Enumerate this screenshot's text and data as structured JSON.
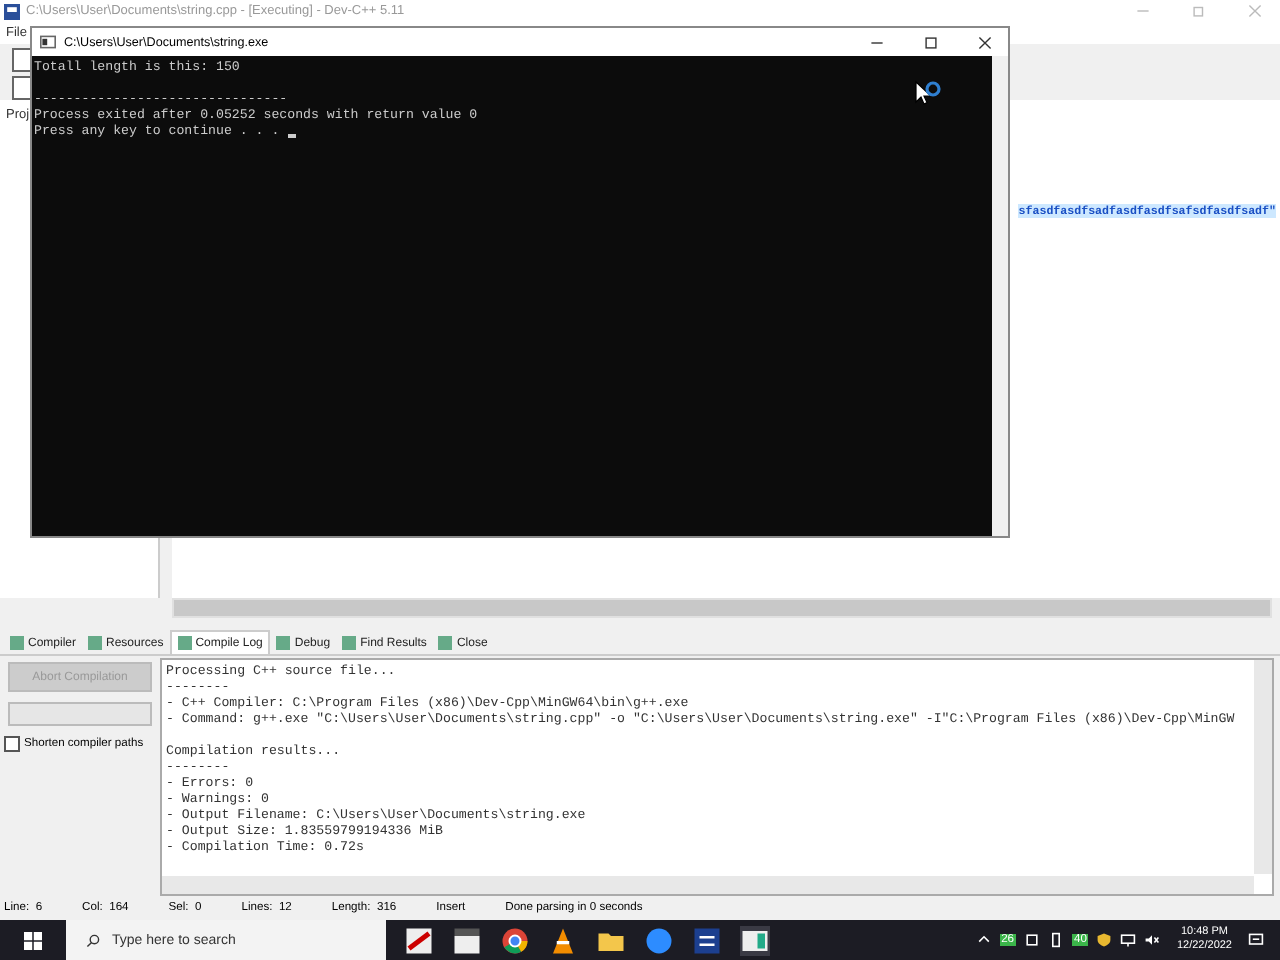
{
  "window": {
    "title": "C:\\Users\\User\\Documents\\string.cpp - [Executing] - Dev-C++ 5.11"
  },
  "menu": [
    "File"
  ],
  "project_tab": "Proj",
  "editor": {
    "visible_line": "sfasdfasdfsadfasdfasdfsafsdfasdfsadf\""
  },
  "console": {
    "title": "C:\\Users\\User\\Documents\\string.exe",
    "paragraphs": [
      [
        "Totall length is this: 150"
      ],
      [
        "--------------------------------",
        "Process exited after 0.05252 seconds with return value 0",
        "Press any key to continue . . . "
      ]
    ]
  },
  "bottom_tabs": [
    {
      "label": "Compiler",
      "selected": false
    },
    {
      "label": "Resources",
      "selected": false
    },
    {
      "label": "Compile Log",
      "selected": true
    },
    {
      "label": "Debug",
      "selected": false
    },
    {
      "label": "Find Results",
      "selected": false
    },
    {
      "label": "Close",
      "selected": false
    }
  ],
  "compile_panel": {
    "progress": {
      "level": 0
    },
    "abort_button": {
      "label": "Abort Compilation",
      "disabled": true
    },
    "shorten_paths": {
      "label": "Shorten compiler paths",
      "checked": false
    },
    "log_paragraphs": [
      [
        "Processing C++ source file...",
        "--------",
        "- C++ Compiler: C:\\Program Files (x86)\\Dev-Cpp\\MinGW64\\bin\\g++.exe",
        "- Command: g++.exe \"C:\\Users\\User\\Documents\\string.cpp\" -o \"C:\\Users\\User\\Documents\\string.exe\"  -I\"C:\\Program Files (x86)\\Dev-Cpp\\MinGW"
      ],
      [
        "Compilation results...",
        "--------",
        "- Errors: 0",
        "- Warnings: 0",
        "- Output Filename: C:\\Users\\User\\Documents\\string.exe",
        "- Output Size: 1.83559799194336 MiB",
        "- Compilation Time: 0.72s"
      ]
    ]
  },
  "status_bar": [
    {
      "label": "Line:",
      "value": "6"
    },
    {
      "label": "Col:",
      "value": "164"
    },
    {
      "label": "Sel:",
      "value": "0"
    },
    {
      "label": "Lines:",
      "value": "12"
    },
    {
      "label": "Length:",
      "value": "316"
    },
    {
      "value": "Insert"
    },
    {
      "value": "Done parsing in 0 seconds"
    }
  ],
  "taskbar": {
    "search_placeholder": "Type here to search",
    "tray_badges": [
      "26",
      "40"
    ],
    "time": "10:48 PM",
    "date": "12/22/2022"
  }
}
